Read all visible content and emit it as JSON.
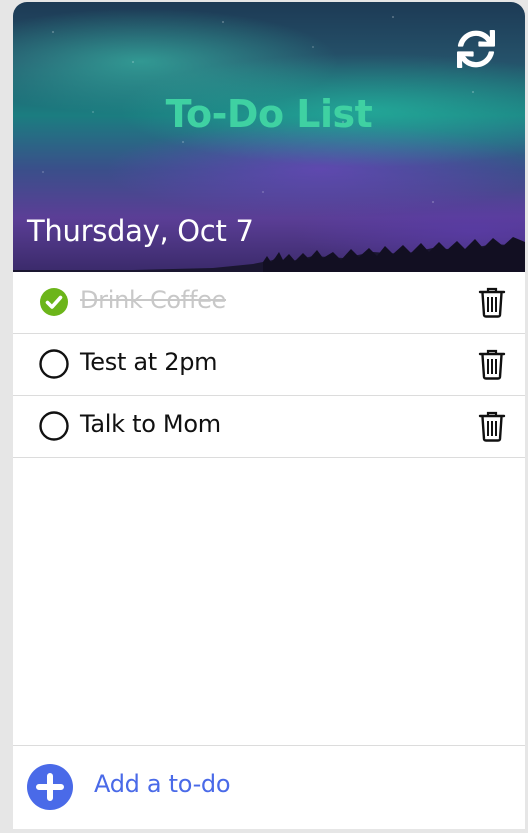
{
  "header": {
    "title": "To-Do List",
    "date": "Thursday, Oct 7",
    "refresh_icon": "refresh-icon",
    "title_color": "#3fd1a2"
  },
  "todos": [
    {
      "label": "Drink Coffee",
      "completed": true
    },
    {
      "label": "Test at 2pm",
      "completed": false
    },
    {
      "label": "Talk to Mom",
      "completed": false
    }
  ],
  "footer": {
    "add_label": "Add a to-do",
    "add_icon": "plus-circle-icon",
    "accent_color": "#4a6ae8"
  },
  "colors": {
    "check_done": "#6cb51a",
    "done_text": "#c8c8c8",
    "add_button": "#4a6ae8"
  }
}
